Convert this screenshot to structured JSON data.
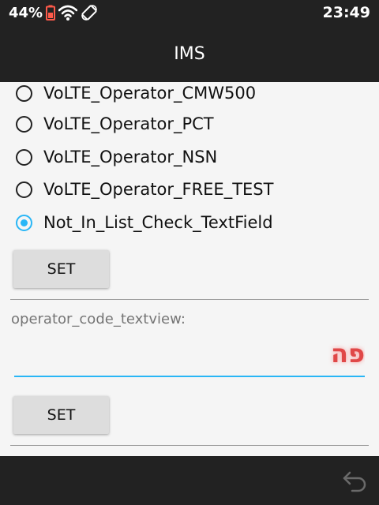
{
  "status_bar": {
    "battery_percent": "44%",
    "time": "23:49",
    "icons": [
      "battery-icon",
      "wifi-icon",
      "rotate-icon"
    ]
  },
  "app_bar": {
    "title": "IMS"
  },
  "operators": [
    {
      "label": "VoLTE_Operator_CMW500",
      "checked": false
    },
    {
      "label": "VoLTE_Operator_PCT",
      "checked": false
    },
    {
      "label": "VoLTE_Operator_NSN",
      "checked": false
    },
    {
      "label": "VoLTE_Operator_FREE_TEST",
      "checked": false
    },
    {
      "label": "Not_In_List_Check_TextField",
      "checked": true
    }
  ],
  "set_button_1": "SET",
  "operator_code": {
    "label": "operator_code_textview:",
    "value": "פה"
  },
  "set_button_2": "SET",
  "nav_bar": {
    "back_icon": "back-icon"
  },
  "colors": {
    "accent": "#29b6f6",
    "bar": "#222222",
    "background": "#f5f5f5",
    "input_text": "#e04848"
  }
}
